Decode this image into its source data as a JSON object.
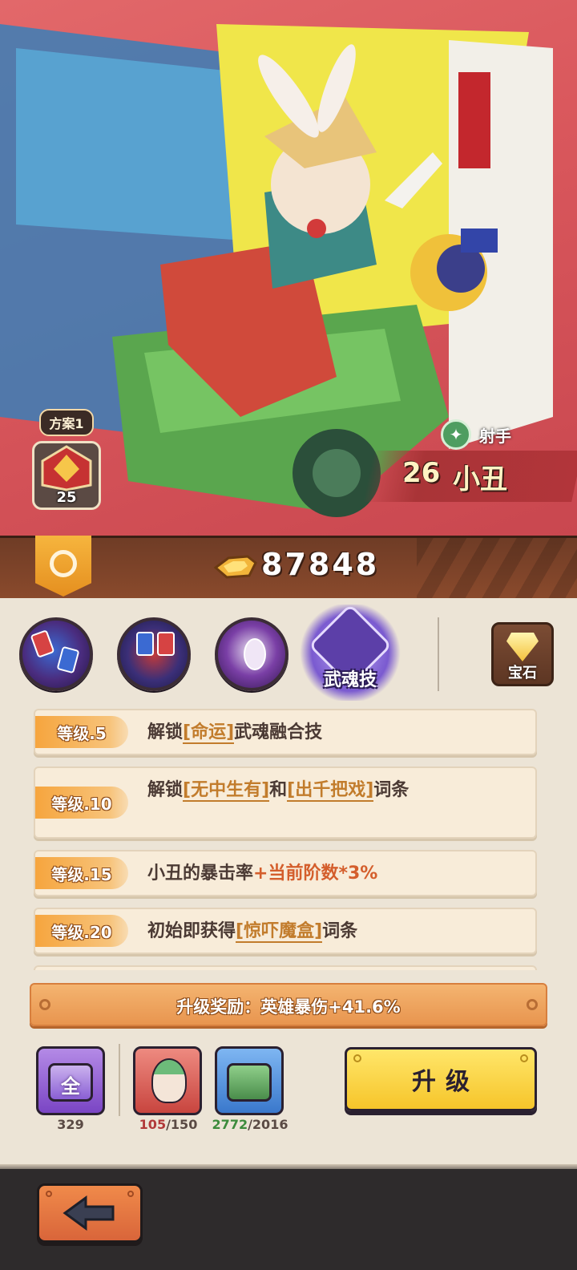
{
  "hero": {
    "plan_label": "方案1",
    "plan_level": "25",
    "class_label": "射手",
    "level": "26",
    "name": "小丑"
  },
  "currency": {
    "gold": "87848"
  },
  "skills": {
    "soul_skill_label": "武魂技",
    "gem_label": "宝石"
  },
  "levels": [
    {
      "tag": "等级.5",
      "pre": "解锁",
      "kw1": "[命运]",
      "mid": "武魂融合技",
      "kw2": "",
      "post": ""
    },
    {
      "tag": "等级.10",
      "pre": "解锁",
      "kw1": "[无中生有]",
      "mid": "和",
      "kw2": "[出千把戏]",
      "post": "词条"
    },
    {
      "tag": "等级.15",
      "pre": "小丑的暴击率",
      "hl": "+当前阶数*3%"
    },
    {
      "tag": "等级.20",
      "pre": "初始即获得",
      "kw1": "[惊吓魔盒]",
      "mid": "词条"
    }
  ],
  "reward": {
    "text": "升级奖励：英雄暴伤+41.6%"
  },
  "items": [
    {
      "icon": "全",
      "count": "329"
    },
    {
      "owned": "105",
      "required": "/150"
    },
    {
      "owned": "2772",
      "required": "/2016"
    }
  ],
  "upgrade_label": "升级",
  "colors": {
    "accent_orange": "#f6a53e",
    "button_yellow": "#f6c52a",
    "hero_bg": "#d9575c"
  }
}
